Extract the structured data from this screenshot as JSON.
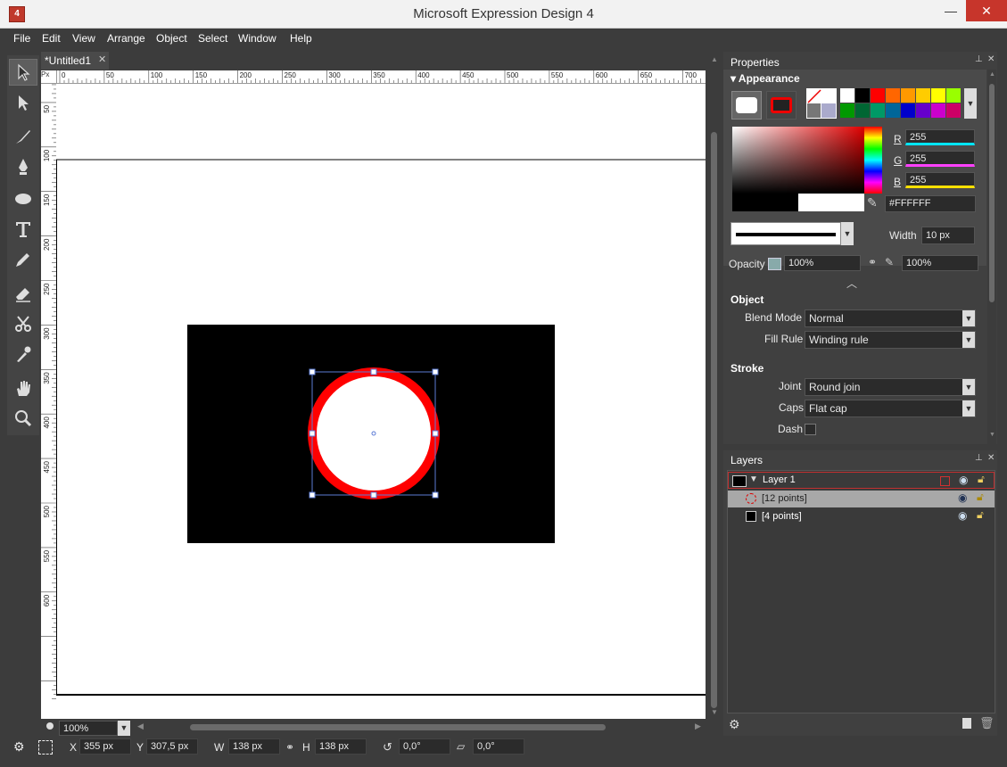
{
  "window": {
    "title": "Microsoft Expression Design 4",
    "app_icon_text": "4"
  },
  "menu": [
    "File",
    "Edit",
    "View",
    "Arrange",
    "Object",
    "Select",
    "Window",
    "Help"
  ],
  "document": {
    "tab_label": "*Untitled1",
    "ruler_unit": "Px",
    "ruler_top_labels": [
      "0",
      "50",
      "100",
      "150",
      "200",
      "250",
      "300",
      "350",
      "400",
      "450",
      "500",
      "550",
      "600",
      "650",
      "700"
    ],
    "ruler_left_labels": [
      "50",
      "100",
      "150",
      "200",
      "250",
      "300",
      "350",
      "400",
      "450",
      "500",
      "550",
      "600"
    ],
    "zoom": "100%"
  },
  "properties": {
    "title": "Properties",
    "appearance_title": "Appearance",
    "swatches_row1": [
      "#ffffff",
      "#000000",
      "#ff0000",
      "#ff6600",
      "#ff9900",
      "#ffcc00",
      "#ffff00",
      "#99ff00"
    ],
    "swatches_row2": [
      "#009900",
      "#006633",
      "#009966",
      "#006699",
      "#0000cc",
      "#6600cc",
      "#cc00cc",
      "#cc0066"
    ],
    "r_label": "R",
    "g_label": "G",
    "b_label": "B",
    "r_value": "255",
    "g_value": "255",
    "b_value": "255",
    "hex_value": "#FFFFFF",
    "width_label": "Width",
    "width_value": "10 px",
    "opacity_label": "Opacity",
    "opacity_value": "100%",
    "opacity_value2": "100%",
    "object_title": "Object",
    "blend_mode_label": "Blend Mode",
    "blend_mode_value": "Normal",
    "fill_rule_label": "Fill Rule",
    "fill_rule_value": "Winding rule",
    "stroke_title": "Stroke",
    "joint_label": "Joint",
    "joint_value": "Round join",
    "caps_label": "Caps",
    "caps_value": "Flat cap",
    "dash_label": "Dash"
  },
  "layers": {
    "title": "Layers",
    "rows": [
      {
        "label": "Layer 1"
      },
      {
        "label": "[12 points]"
      },
      {
        "label": "[4 points]"
      }
    ]
  },
  "status": {
    "x_label": "X",
    "x_value": "355 px",
    "y_label": "Y",
    "y_value": "307,5 px",
    "w_label": "W",
    "w_value": "138 px",
    "h_label": "H",
    "h_value": "138 px",
    "rotation_value": "0,0°",
    "skew_value": "0,0°"
  },
  "colors": {
    "accent_red": "#ff0000",
    "selection_blue": "#5b7bd5",
    "panel": "#404040"
  }
}
